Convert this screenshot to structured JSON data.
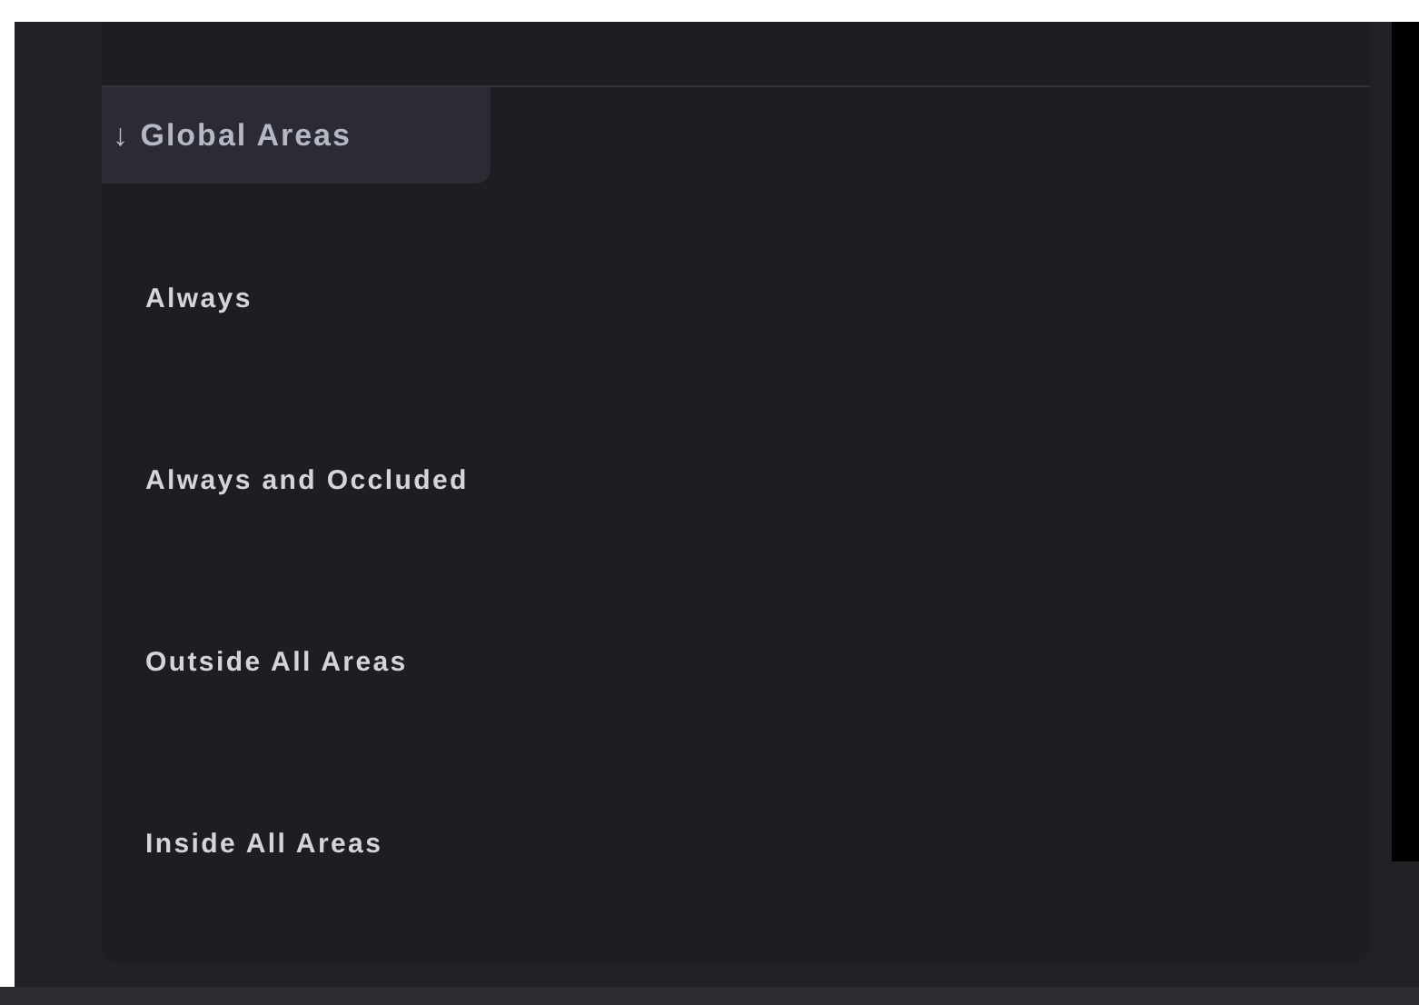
{
  "section": {
    "icon": "↓",
    "title": "Global Areas",
    "expanded": true
  },
  "options": [
    {
      "label": "Always"
    },
    {
      "label": "Always and Occluded"
    },
    {
      "label": "Outside All Areas"
    },
    {
      "label": "Inside All Areas"
    }
  ]
}
